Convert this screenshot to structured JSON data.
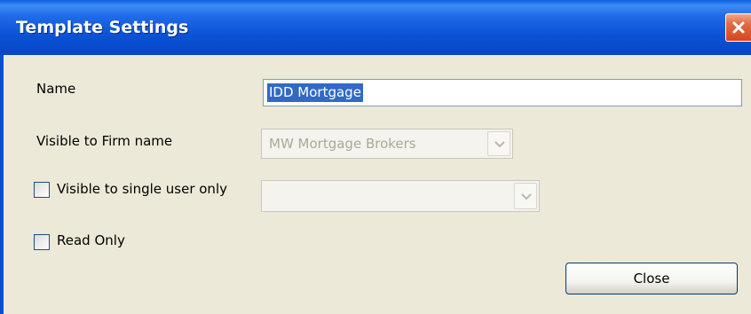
{
  "window": {
    "title": "Template Settings"
  },
  "form": {
    "name_label": "Name",
    "name_value": "IDD Mortgage",
    "firm_label": "Visible to Firm name",
    "firm_value": "MW Mortgage Brokers",
    "single_user_label": "Visible to single user only",
    "single_user_checked": false,
    "single_user_value": "",
    "read_only_label": "Read Only",
    "read_only_checked": false
  },
  "buttons": {
    "close_label": "Close"
  },
  "colors": {
    "title_bar": "#0a52d6",
    "close_button": "#e26b45",
    "dialog_bg": "#ece9d8",
    "selection": "#316ac5"
  }
}
